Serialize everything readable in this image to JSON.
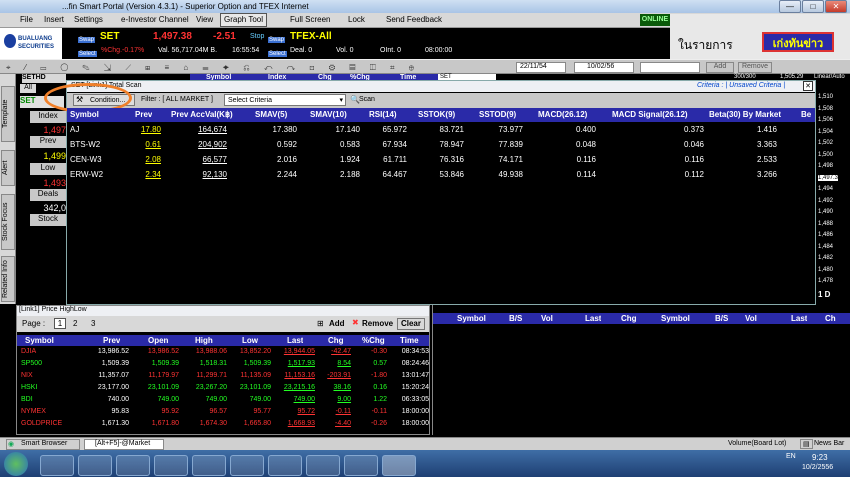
{
  "window": {
    "title": "...fin Smart Portal (Version 4.3.1) - Superior Option and TFEX Internet",
    "controls": [
      "—",
      "□",
      "✕"
    ]
  },
  "menu": [
    "File",
    "Insert",
    "Settings",
    "e-Investor Channel",
    "View",
    "Graph Tool",
    "Full Screen",
    "Lock",
    "Send Feedback"
  ],
  "menu_active": "Graph Tool",
  "online": "ONLINE",
  "logo": {
    "line1": "BUALUANG",
    "line2": "SECURITIES"
  },
  "ticker": {
    "swap1": "Swap",
    "symbol": "SET",
    "price": "1,497.38",
    "change": "-2.51",
    "select1": "Select",
    "pct": "%Chg.-0.17%",
    "val": "Val. 56,717.04M B.",
    "time": "16:55:54",
    "stop": "Stop",
    "swap2": "Swap",
    "tfex": "TFEX-All",
    "select2": "Select",
    "deal": "Deal. 0",
    "vol": "Vol. 0",
    "oint": "OInt. 0",
    "ttime": "08:00:00"
  },
  "ad": {
    "text": "ในรายการ",
    "badge": "เก่งทันข่าว"
  },
  "toolbar": {
    "date1": "22/11/54",
    "date2": "10/02/56",
    "add": "Add",
    "remove": "Remove",
    "mini_cols": [
      "Symbol",
      "Index",
      "Chg",
      "%Chg",
      "Time"
    ],
    "mini_set": "SET",
    "right_vals": [
      "300/300",
      "1,505.29",
      "Linear/Auto"
    ]
  },
  "set_panel": {
    "title": "SETHD",
    "all": "All",
    "set": "SET",
    "labels": [
      "Index",
      "Prev",
      "Low",
      "Deals",
      "Stock"
    ],
    "values": [
      "1,497",
      "1,499",
      "1,493",
      "342,0"
    ]
  },
  "left_tabs": [
    "Template",
    "Alert",
    "Stock Focus",
    "Related Info"
  ],
  "scan": {
    "title": "SET [Link1] Total Scan",
    "criteria_label": "Criteria : | Unsaved Criteria |",
    "condition_btn": "Condition...",
    "filter": "Filter : [ ALL MARKET ]",
    "select_criteria": "Select Criteria",
    "scan_btn": "Scan",
    "columns": [
      "Symbol",
      "Prev",
      "Prev AccVal(K฿)",
      "SMAV(5)",
      "SMAV(10)",
      "RSI(14)",
      "SSTOK(9)",
      "SSTOD(9)",
      "MACD(26.12)",
      "MACD Signal(26.12)",
      "Beta(30) By Market",
      "Be"
    ],
    "rows": [
      [
        "AJ",
        "17.80",
        "164,674",
        "17.380",
        "17.140",
        "65.972",
        "83.721",
        "73.977",
        "0.400",
        "0.373",
        "1.416"
      ],
      [
        "BTS-W2",
        "0.61",
        "204,902",
        "0.592",
        "0.583",
        "67.934",
        "78.947",
        "77.839",
        "0.048",
        "0.046",
        "3.363"
      ],
      [
        "CEN-W3",
        "2.08",
        "66,577",
        "2.016",
        "1.924",
        "61.711",
        "76.316",
        "74.171",
        "0.116",
        "0.116",
        "2.533"
      ],
      [
        "ERW-W2",
        "2.34",
        "92,130",
        "2.244",
        "2.188",
        "64.467",
        "53.846",
        "49.938",
        "0.114",
        "0.112",
        "3.266"
      ]
    ]
  },
  "right_axis": [
    "1,510",
    "1,508",
    "1,506",
    "1,504",
    "1,502",
    "1,500",
    "1,498",
    "1,497.3",
    "1,494",
    "1,492",
    "1,490",
    "1,488",
    "1,486",
    "1,484",
    "1,482",
    "1,480",
    "1,478",
    "1 D"
  ],
  "highlow": {
    "title": "[Link1] Price HighLow",
    "page_label": "Page :",
    "pages": [
      "1",
      "2",
      "3"
    ],
    "add": "Add",
    "remove": "Remove",
    "clear": "Clear",
    "columns": [
      "Symbol",
      "Prev",
      "Open",
      "High",
      "Low",
      "Last",
      "Chg",
      "%Chg",
      "Time"
    ],
    "rows": [
      {
        "cells": [
          "DJIA",
          "13,986.52",
          "13,986.52",
          "13,988.06",
          "13,852.20",
          "13,944.05",
          "-42.47",
          "-0.30",
          "08:34:53"
        ],
        "color": "red"
      },
      {
        "cells": [
          "SP500",
          "1,509.39",
          "1,509.39",
          "1,518.31",
          "1,509.39",
          "1,517.93",
          "8.54",
          "0.57",
          "08:24:46"
        ],
        "color": "green"
      },
      {
        "cells": [
          "NIX",
          "11,357.07",
          "11,179.97",
          "11,299.71",
          "11,135.09",
          "11,153.16",
          "-203.91",
          "-1.80",
          "13:01:47"
        ],
        "color": "red"
      },
      {
        "cells": [
          "HSKI",
          "23,177.00",
          "23,101.09",
          "23,267.20",
          "23,101.09",
          "23,215.16",
          "38.16",
          "0.16",
          "15:20:24"
        ],
        "color": "green"
      },
      {
        "cells": [
          "BDI",
          "740.00",
          "749.00",
          "749.00",
          "749.00",
          "749.00",
          "9.00",
          "1.22",
          "06:33:05"
        ],
        "color": "green"
      },
      {
        "cells": [
          "NYMEX",
          "95.83",
          "95.92",
          "96.57",
          "95.77",
          "95.72",
          "-0.11",
          "-0.11",
          "18:00:00"
        ],
        "color": "red"
      },
      {
        "cells": [
          "GOLDPRICE",
          "1,671.30",
          "1,671.80",
          "1,674.30",
          "1,665.80",
          "1,668.93",
          "-4.40",
          "-0.26",
          "18:00:00"
        ],
        "color": "red"
      }
    ]
  },
  "right_grid": {
    "columns": [
      "Symbol",
      "B/S",
      "Vol",
      "Last",
      "Chg",
      "Symbol",
      "B/S",
      "Vol",
      "Last",
      "Ch"
    ]
  },
  "status": {
    "smart_browser": "Smart Browser",
    "market_tab": "[Alt+F5]-@Market",
    "volume": "Volume(Board Lot)",
    "news": "News Bar"
  },
  "taskbar": {
    "lang": "EN",
    "time": "9:23",
    "date": "10/2/2556"
  }
}
